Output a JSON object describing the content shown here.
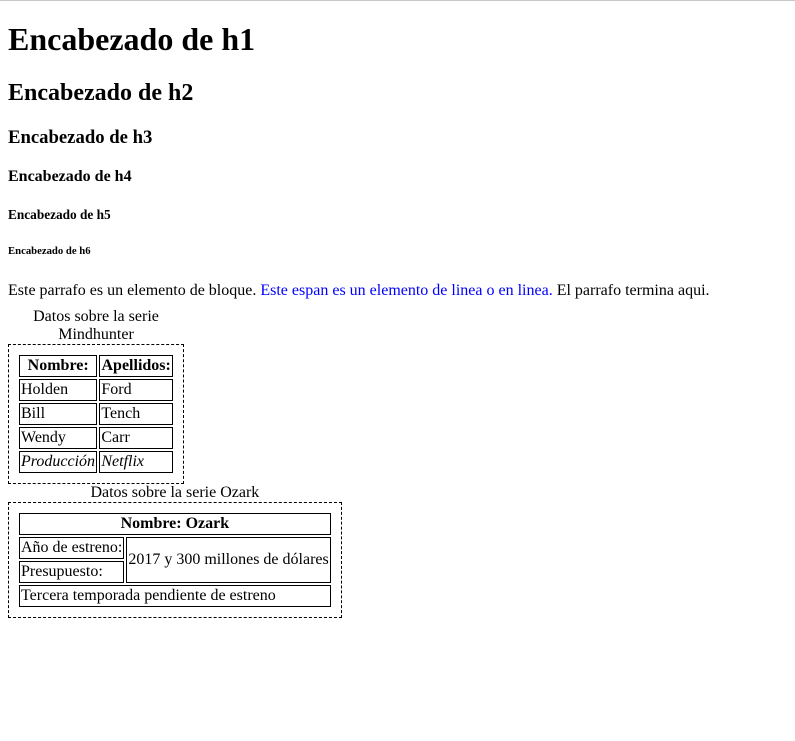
{
  "headings": {
    "h1": "Encabezado de h1",
    "h2": "Encabezado de h2",
    "h3": "Encabezado de h3",
    "h4": "Encabezado de h4",
    "h5": "Encabezado de h5",
    "h6": "Encabezado de h6"
  },
  "paragraph": {
    "before": "Este parrafo es un elemento de bloque. ",
    "span": "Este espan es un elemento de linea o en linea.",
    "after": " El parrafo termina aqui."
  },
  "table1": {
    "caption": "Datos sobre la serie Mindhunter",
    "headers": [
      "Nombre:",
      "Apellidos:"
    ],
    "rows": [
      [
        "Holden",
        "Ford"
      ],
      [
        "Bill",
        "Tench"
      ],
      [
        "Wendy",
        "Carr"
      ],
      [
        "Producción",
        "Netflix"
      ]
    ]
  },
  "table2": {
    "caption": "Datos sobre la serie Ozark",
    "header": "Nombre: Ozark",
    "row_label_1": "Año de estreno:",
    "row_label_2": "Presupuesto:",
    "merged_value": "2017 y 300 millones de dólares",
    "footer": "Tercera temporada pendiente de estreno"
  },
  "colors": {
    "text": "#000000",
    "span": "#0000ff",
    "background": "#ffffff"
  }
}
